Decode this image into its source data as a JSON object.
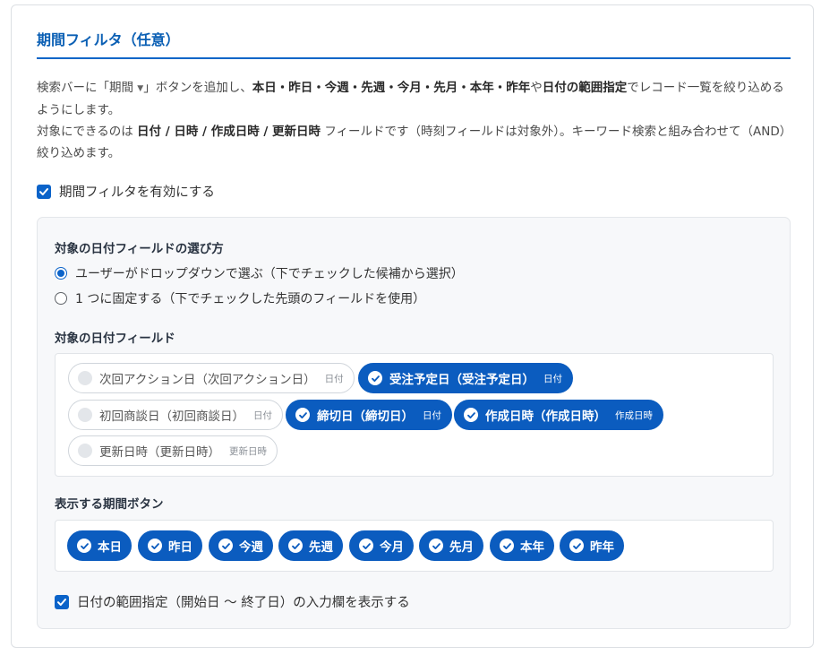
{
  "section": {
    "title": "期間フィルタ（任意）"
  },
  "description": {
    "l1_a": "検索バーに「期間",
    "l1_b": "」ボタンを追加し、",
    "l1_bold": "本日・昨日・今週・先週・今月・先月・本年・昨年",
    "l1_c": "や",
    "l1_bold2": "日付の範囲指定",
    "l1_d": "でレコード一覧を絞り込めるようにします。",
    "l2_a": "対象にできるのは",
    "l2_bold": "日付 / 日時 / 作成日時 / 更新日時",
    "l2_b": "フィールドです（時刻フィールドは対象外）。キーワード検索と組み合わせて（AND）絞り込めます。"
  },
  "enable": {
    "checked": true,
    "label": "期間フィルタを有効にする"
  },
  "field_mode": {
    "label": "対象の日付フィールドの選び方",
    "options": [
      {
        "label": "ユーザーがドロップダウンで選ぶ（下でチェックした候補から選択）",
        "selected": true
      },
      {
        "label": "1 つに固定する（下でチェックした先頭のフィールドを使用）",
        "selected": false
      }
    ]
  },
  "fields": {
    "label": "対象の日付フィールド",
    "items": [
      {
        "label": "次回アクション日（次回アクション日）",
        "type": "日付",
        "checked": false
      },
      {
        "label": "受注予定日（受注予定日）",
        "type": "日付",
        "checked": true
      },
      {
        "label": "初回商談日（初回商談日）",
        "type": "日付",
        "checked": false
      },
      {
        "label": "締切日（締切日）",
        "type": "日付",
        "checked": true
      },
      {
        "label": "作成日時（作成日時）",
        "type": "作成日時",
        "checked": true
      },
      {
        "label": "更新日時（更新日時）",
        "type": "更新日時",
        "checked": false
      }
    ]
  },
  "period_buttons": {
    "label": "表示する期間ボタン",
    "items": [
      {
        "label": "本日",
        "checked": true
      },
      {
        "label": "昨日",
        "checked": true
      },
      {
        "label": "今週",
        "checked": true
      },
      {
        "label": "先週",
        "checked": true
      },
      {
        "label": "今月",
        "checked": true
      },
      {
        "label": "先月",
        "checked": true
      },
      {
        "label": "本年",
        "checked": true
      },
      {
        "label": "昨年",
        "checked": true
      }
    ]
  },
  "range": {
    "checked": true,
    "label": "日付の範囲指定（開始日 〜 終了日）の入力欄を表示する"
  },
  "colors": {
    "accent": "#0b5cbf",
    "title": "#0a5fb4"
  }
}
